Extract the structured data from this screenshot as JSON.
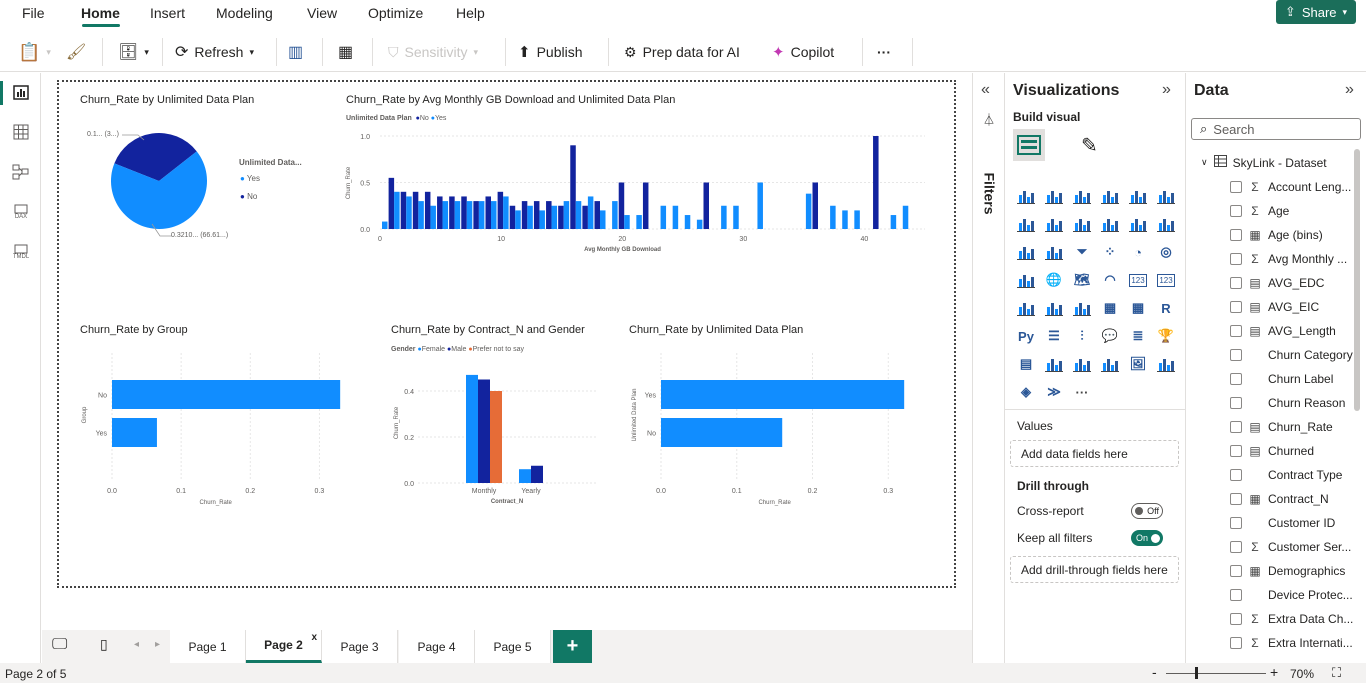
{
  "menu": {
    "items": [
      "File",
      "Home",
      "Insert",
      "Modeling",
      "View",
      "Optimize",
      "Help"
    ],
    "share": "Share"
  },
  "ribbon": {
    "refresh": "Refresh",
    "sensitivity": "Sensitivity",
    "publish": "Publish",
    "prep": "Prep data for AI",
    "copilot": "Copilot",
    "more": "···"
  },
  "pie_chart": {
    "title": "Churn_Rate by Unlimited Data Plan",
    "legend_title": "Unlimited Data...",
    "legend": [
      "Yes",
      "No"
    ],
    "label_small": "0.1... (3...)",
    "label_large": "0.3210... (66.61...)",
    "chart_data": {
      "type": "pie",
      "categories": [
        "Yes",
        "No"
      ],
      "values": [
        0.321,
        0.1
      ],
      "percent": [
        66.61,
        33.39
      ]
    }
  },
  "column_chart": {
    "title": "Churn_Rate by Avg Monthly GB Download and Unlimited Data Plan",
    "legend_title": "Unlimited Data Plan",
    "legend": [
      "No",
      "Yes"
    ],
    "xlabel": "Avg Monthly GB Download",
    "ylabel": "Churn_Rate",
    "yticks": [
      "1.0",
      "0.5",
      "0.0"
    ],
    "xticks": [
      "0",
      "10",
      "20",
      "30",
      "40"
    ],
    "chart_data": {
      "type": "bar",
      "xlim": [
        0,
        45
      ],
      "ylim": [
        0,
        1
      ],
      "series": [
        {
          "name": "No",
          "x": [
            1,
            2,
            3,
            4,
            5,
            6,
            7,
            8,
            9,
            10,
            11,
            12,
            13,
            14,
            15,
            16,
            17,
            18,
            20,
            22,
            27,
            36,
            41
          ],
          "values": [
            0.55,
            0.4,
            0.4,
            0.4,
            0.35,
            0.35,
            0.35,
            0.3,
            0.35,
            0.4,
            0.25,
            0.3,
            0.3,
            0.3,
            0.25,
            0.9,
            0.25,
            0.3,
            0.5,
            0.5,
            0.5,
            0.5,
            1.0
          ]
        },
        {
          "name": "Yes",
          "x": [
            0,
            1,
            2,
            3,
            4,
            5,
            6,
            7,
            8,
            9,
            10,
            11,
            12,
            13,
            14,
            15,
            16,
            17,
            18,
            19,
            20,
            21,
            23,
            24,
            25,
            26,
            28,
            29,
            31,
            35,
            37,
            38,
            39,
            42,
            43
          ],
          "values": [
            0.08,
            0.4,
            0.35,
            0.3,
            0.25,
            0.3,
            0.3,
            0.3,
            0.3,
            0.3,
            0.35,
            0.2,
            0.25,
            0.2,
            0.25,
            0.3,
            0.3,
            0.35,
            0.2,
            0.3,
            0.15,
            0.15,
            0.25,
            0.25,
            0.15,
            0.1,
            0.25,
            0.25,
            0.5,
            0.38,
            0.25,
            0.2,
            0.2,
            0.15,
            0.25
          ]
        }
      ]
    }
  },
  "group_chart": {
    "title": "Churn_Rate by Group",
    "ylabel": "Group",
    "xlabel": "Churn_Rate",
    "categories": [
      "No",
      "Yes"
    ],
    "xticks": [
      "0.0",
      "0.1",
      "0.2",
      "0.3"
    ],
    "chart_data": {
      "type": "bar",
      "orientation": "horizontal",
      "categories": [
        "No",
        "Yes"
      ],
      "values": [
        0.33,
        0.065
      ],
      "xlim": [
        0,
        0.35
      ]
    }
  },
  "contract_chart": {
    "title": "Churn_Rate by Contract_N and Gender",
    "legend_title": "Gender",
    "legend": [
      "Female",
      "Male",
      "Prefer not to say"
    ],
    "xlabel": "Contract_N",
    "ylabel": "Churn_Rate",
    "categories": [
      "Monthly",
      "Yearly"
    ],
    "yticks": [
      "0.4",
      "0.2",
      "0.0"
    ],
    "chart_data": {
      "type": "bar",
      "categories": [
        "Monthly",
        "Yearly"
      ],
      "ylim": [
        0,
        0.5
      ],
      "series": [
        {
          "name": "Female",
          "values": [
            0.47,
            0.06
          ]
        },
        {
          "name": "Male",
          "values": [
            0.45,
            0.075
          ]
        },
        {
          "name": "Prefer not to say",
          "values": [
            0.4,
            0
          ]
        }
      ]
    }
  },
  "plan_chart": {
    "title": "Churn_Rate by Unlimited Data Plan",
    "ylabel": "Unlimited Data Plan",
    "xlabel": "Churn_Rate",
    "categories": [
      "Yes",
      "No"
    ],
    "xticks": [
      "0.0",
      "0.1",
      "0.2",
      "0.3"
    ],
    "chart_data": {
      "type": "bar",
      "orientation": "horizontal",
      "categories": [
        "Yes",
        "No"
      ],
      "values": [
        0.321,
        0.16
      ],
      "xlim": [
        0,
        0.33
      ]
    }
  },
  "filters": {
    "label": "Filters"
  },
  "viz": {
    "title": "Visualizations",
    "build": "Build visual",
    "values": "Values",
    "add_data": "Add data fields here",
    "drill": "Drill through",
    "cross": "Cross-report",
    "cross_state": "Off",
    "keep": "Keep all filters",
    "keep_state": "On",
    "add_drill": "Add drill-through fields here"
  },
  "data": {
    "title": "Data",
    "search": "Search",
    "dataset": "SkyLink - Dataset",
    "fields": [
      {
        "icon": "Σ",
        "label": "Account Leng..."
      },
      {
        "icon": "Σ",
        "label": "Age"
      },
      {
        "icon": "▦",
        "label": "Age (bins)"
      },
      {
        "icon": "Σ",
        "label": "Avg Monthly ..."
      },
      {
        "icon": "▤",
        "label": "AVG_EDC"
      },
      {
        "icon": "▤",
        "label": "AVG_EIC"
      },
      {
        "icon": "▤",
        "label": "AVG_Length"
      },
      {
        "icon": "",
        "label": "Churn Category"
      },
      {
        "icon": "",
        "label": "Churn Label"
      },
      {
        "icon": "",
        "label": "Churn Reason"
      },
      {
        "icon": "▤",
        "label": "Churn_Rate"
      },
      {
        "icon": "▤",
        "label": "Churned"
      },
      {
        "icon": "",
        "label": "Contract Type"
      },
      {
        "icon": "▦",
        "label": "Contract_N"
      },
      {
        "icon": "",
        "label": "Customer ID"
      },
      {
        "icon": "Σ",
        "label": "Customer Ser..."
      },
      {
        "icon": "▦",
        "label": "Demographics"
      },
      {
        "icon": "",
        "label": "Device Protec..."
      },
      {
        "icon": "Σ",
        "label": "Extra Data Ch..."
      },
      {
        "icon": "Σ",
        "label": "Extra Internati..."
      }
    ]
  },
  "tabs": [
    "Page 1",
    "Page 2",
    "Page 3",
    "Page 4",
    "Page 5"
  ],
  "status": {
    "page": "Page 2 of 5",
    "zoom": "70%"
  },
  "colors": {
    "accent": "#117865",
    "bar_light": "#118dff",
    "bar_dark": "#12239e",
    "bar_orange": "#e66c37"
  }
}
